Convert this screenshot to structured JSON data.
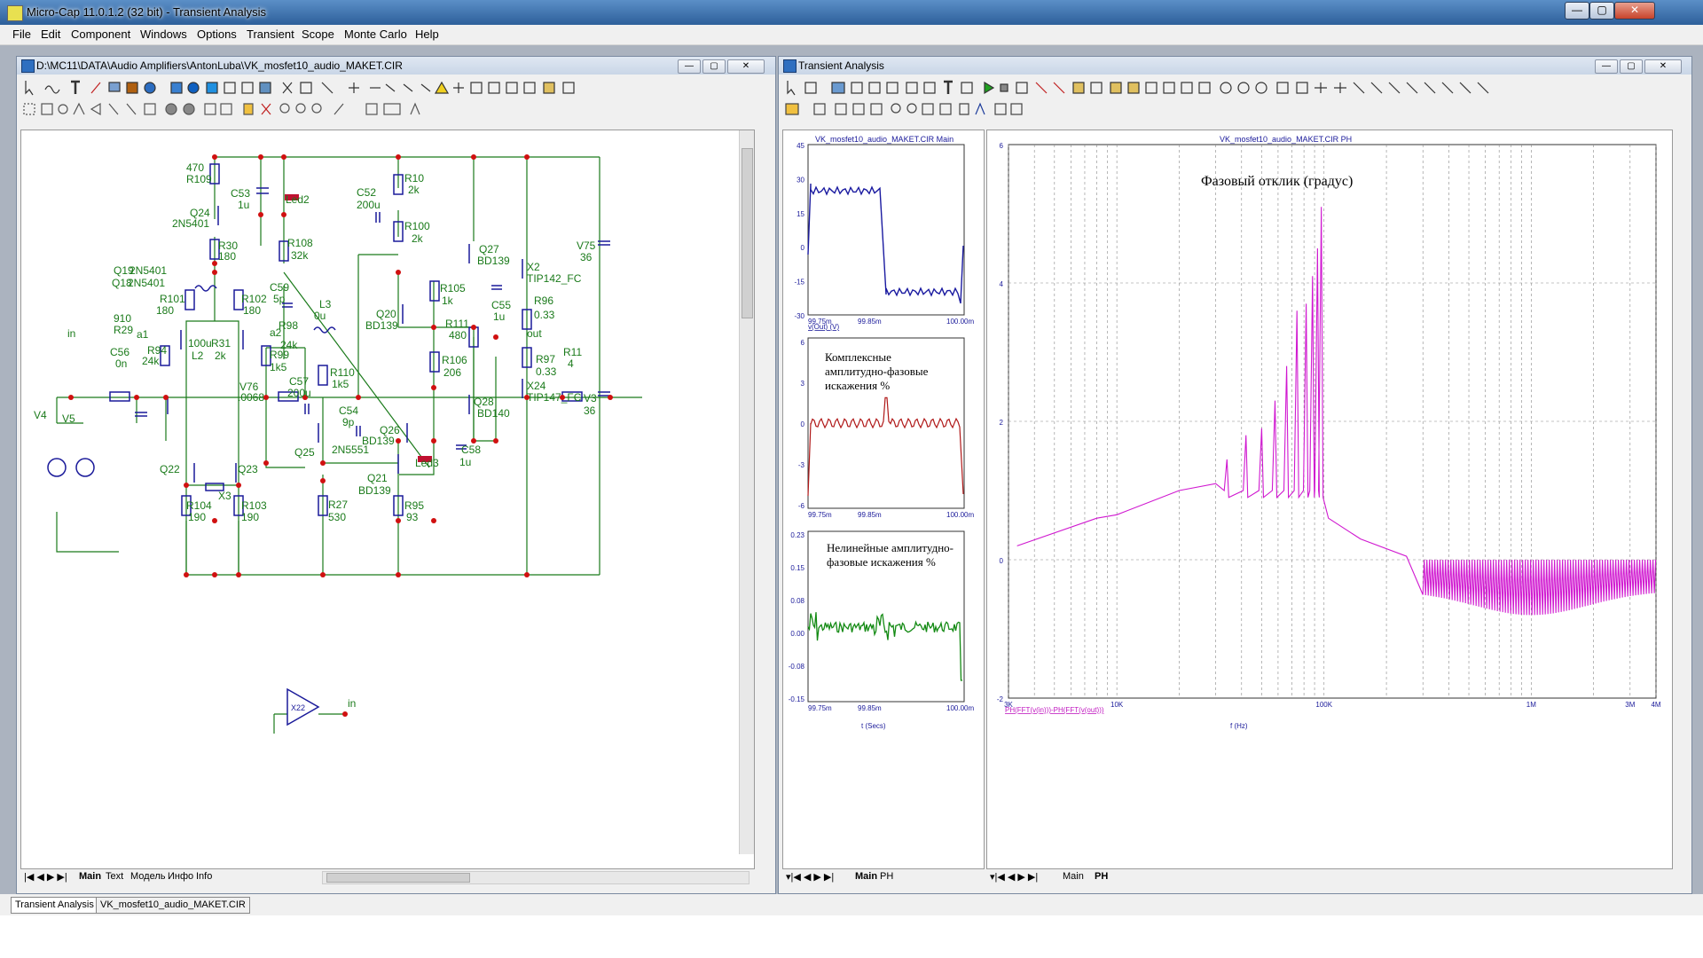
{
  "window": {
    "title": "Micro-Cap 11.0.1.2 (32 bit) - Transient Analysis",
    "btn_min": "—",
    "btn_max": "▢",
    "btn_close": "✕"
  },
  "menu": [
    "File",
    "Edit",
    "Component",
    "Windows",
    "Options",
    "Transient",
    "Scope",
    "Monte Carlo",
    "Help"
  ],
  "schematic": {
    "title": "D:\\MC11\\DATA\\Audio Amplifiers\\AntonLuba\\VK_mosfet10_audio_MAKET.CIR",
    "labels": [
      "470",
      "R109",
      "C53",
      "1u",
      "Led2",
      "Q24",
      "2N5401",
      "R30",
      "180",
      "R108",
      "32k",
      "C52",
      "200u",
      "R10",
      "2k",
      "R100",
      "2k",
      "Q27",
      "BD139",
      "X2",
      "TIP142_FC",
      "V75",
      "36",
      "Q19",
      "2N5401",
      "Q18",
      "2N5401",
      "R101",
      "180",
      "R102",
      "180",
      "C59",
      "5p",
      "R98",
      "24k",
      "L3",
      "0u",
      "R105",
      "1k",
      "C55",
      "1u",
      "R96",
      "0.33",
      "Q20",
      "BD139",
      "R111",
      "480",
      "out",
      "R11",
      "4",
      "910",
      "R29",
      "in",
      "a1",
      "a2",
      "C56",
      "0n",
      "R94",
      "24k",
      "100u",
      "R31",
      "2k",
      "L2",
      "R99",
      "1k5",
      "R106",
      "206",
      "R97",
      "0.33",
      "X24",
      "TIP147_FC",
      "V3",
      "36",
      "V4",
      "V5",
      "V76",
      ".0068",
      "C57",
      "200u",
      "R110",
      "1k5",
      "Q28",
      "BD140",
      "C54",
      "9p",
      "Q26",
      "BD139",
      "Q25",
      "2N5551",
      "Led3",
      "C58",
      "1u",
      "Q22",
      "Q23",
      "X3",
      "Q21",
      "BD139",
      "R104",
      "190",
      "R103",
      "190",
      "R27",
      "530",
      "R95",
      "93",
      "X22",
      "in"
    ],
    "tabs": [
      "Main",
      "Text",
      "Модель",
      "Инфо",
      "Info"
    ],
    "active_tab": "Main"
  },
  "transient": {
    "title": "Transient Analysis",
    "plot1": {
      "title": "VK_mosfet10_audio_MAKET.CIR Main",
      "yticks": [
        "45",
        "30",
        "15",
        "0",
        "-15",
        "-30"
      ],
      "xticks": [
        "99.75m",
        "99.85m",
        "100.00m"
      ],
      "trace_label": "v(Out) (V)",
      "color": "#1a1aa0"
    },
    "plot2": {
      "annotation_line1": "Комплексные",
      "annotation_line2": "амплитудно-фазовые",
      "annotation_line3": "искажения %",
      "yticks": [
        "6",
        "3",
        "0",
        "-3",
        "-6"
      ],
      "xticks": [
        "99.75m",
        "99.85m",
        "100.00m"
      ],
      "color": "#b01818"
    },
    "plot3": {
      "annotation_line1": "Нелинейные амплитудно-",
      "annotation_line2": "фазовые искажения %",
      "yticks": [
        "0.23",
        "0.15",
        "0.08",
        "0.00",
        "-0.08",
        "-0.15"
      ],
      "xticks": [
        "99.75m",
        "99.85m",
        "100.00m"
      ],
      "xlabel": "t (Secs)",
      "color": "#138a13"
    },
    "plot4": {
      "title": "VK_mosfet10_audio_MAKET.CIR PH",
      "annotation": "Фазовый отклик (градус)",
      "yticks": [
        "6",
        "4",
        "2",
        "0",
        "-2"
      ],
      "xticks": [
        "3K",
        "10K",
        "100K",
        "1M",
        "3M",
        "4M"
      ],
      "trace_label": "PH(FFT(v(in)))-PH(FFT(v(out)))",
      "xlabel": "f (Hz)",
      "color": "#d018d0"
    },
    "left_tabs": [
      "Main",
      "PH"
    ],
    "right_tabs": [
      "Main",
      "PH"
    ]
  },
  "bottom_tabs": [
    "Transient Analysis",
    "VK_mosfet10_audio_MAKET.CIR"
  ]
}
